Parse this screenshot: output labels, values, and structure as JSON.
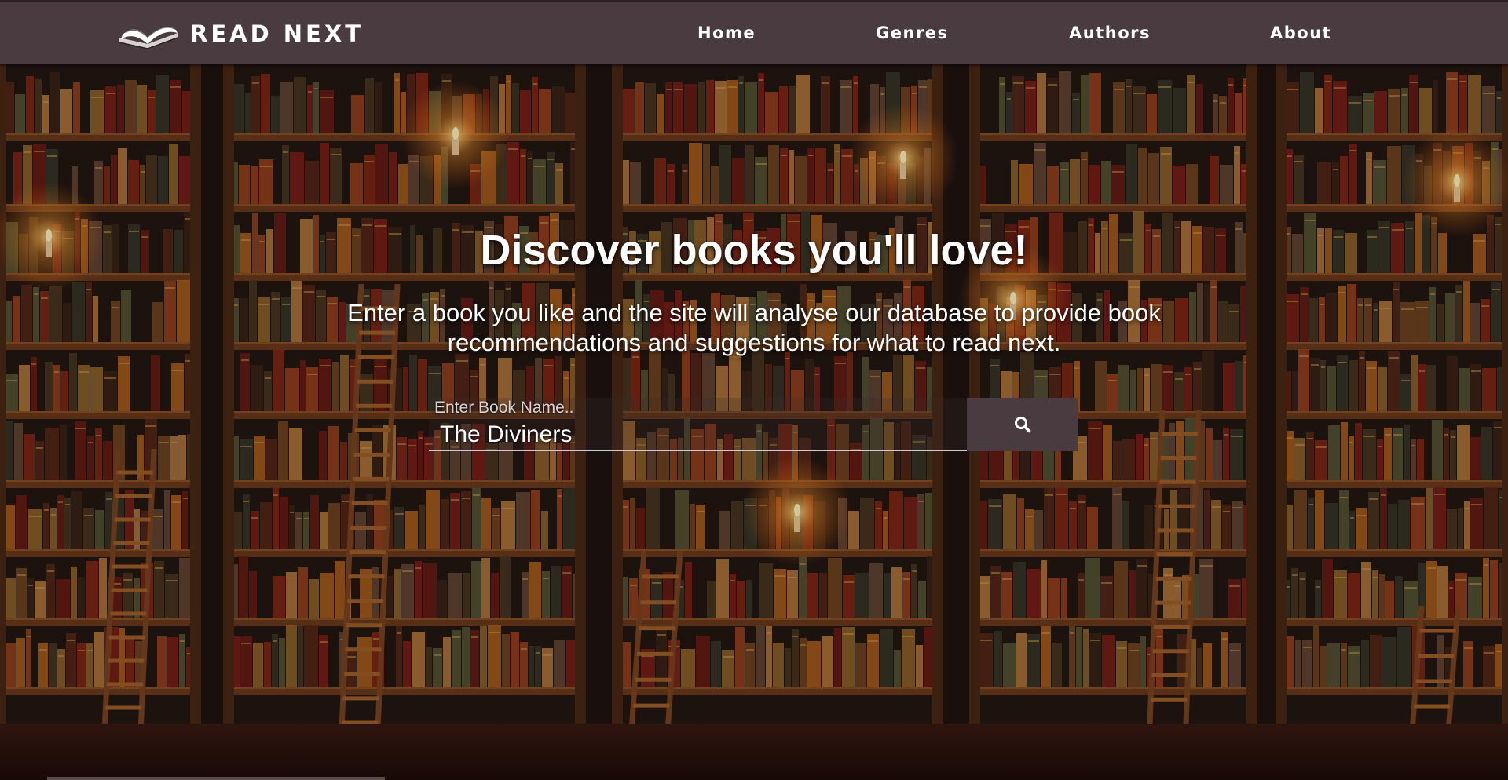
{
  "navbar": {
    "brand_text": "READ NEXT",
    "brand_icon": "open-book-icon",
    "links": [
      {
        "label": "Home"
      },
      {
        "label": "Genres"
      },
      {
        "label": "Authors"
      },
      {
        "label": "About"
      }
    ],
    "background_color": "#4a3b40"
  },
  "hero": {
    "title": "Discover books you'll love!",
    "subtitle": "Enter a book you like and the site will analyse our database to provide book recommendations and suggestions for what to read next.",
    "background": "library-bookshelves-with-ladders-and-candles"
  },
  "search": {
    "label": "Enter Book Name..",
    "value": "The Diviners",
    "button_icon": "search-icon"
  }
}
